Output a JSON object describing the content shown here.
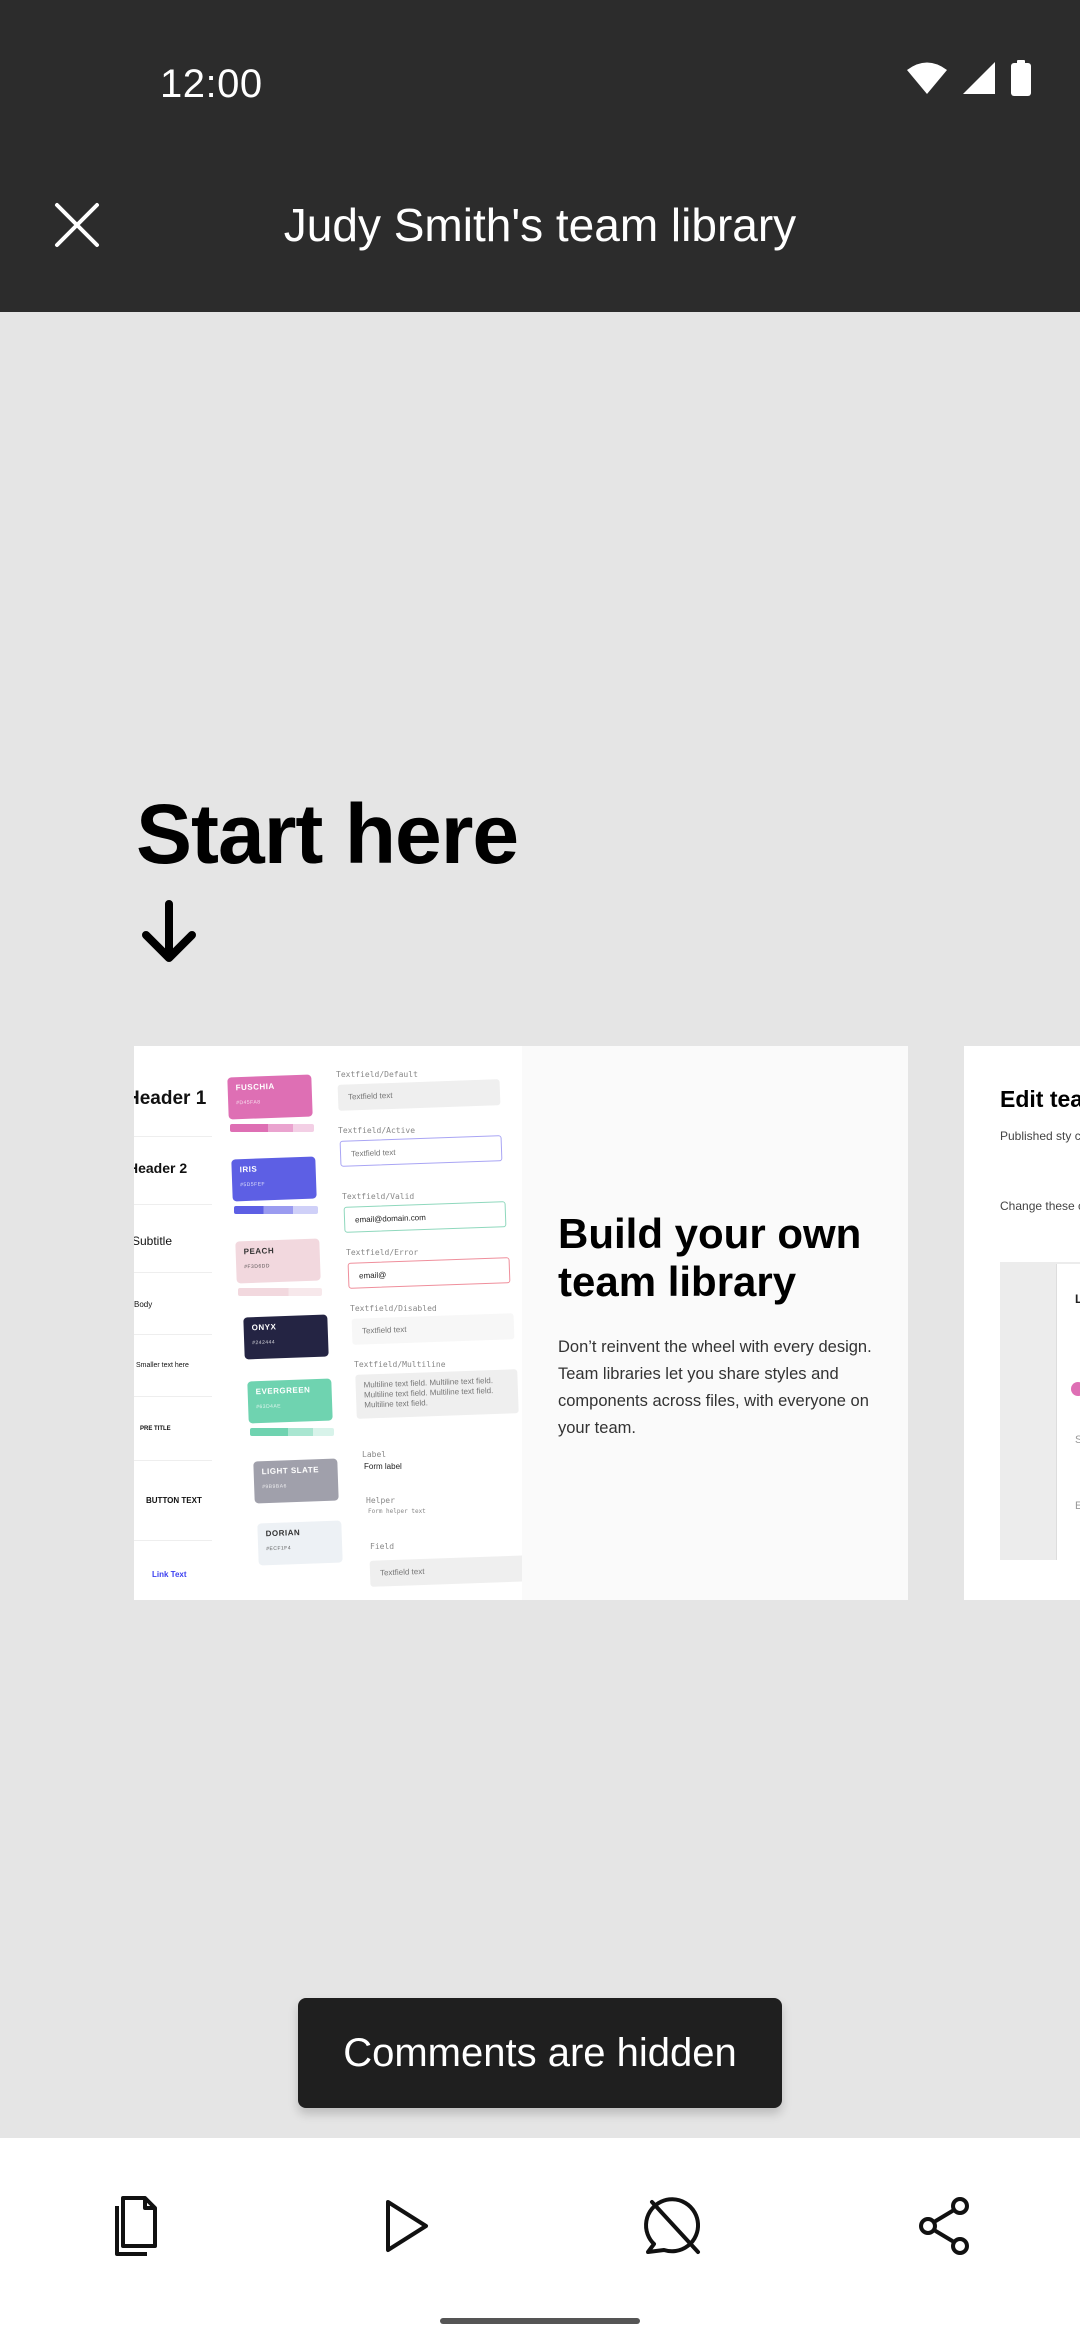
{
  "status_bar": {
    "time": "12:00",
    "icons": [
      "wifi-icon",
      "cellular-icon",
      "battery-icon"
    ]
  },
  "header": {
    "title": "Judy Smith's team library",
    "close_icon": "close-icon"
  },
  "canvas": {
    "start_heading": "Start here",
    "arrow_icon": "arrow-down-icon",
    "main_frame": {
      "type_styles": [
        "Header 1",
        "Header 2",
        "Subtitle",
        "Body",
        "Smaller text here",
        "PRE TITLE",
        "BUTTON TEXT",
        "Link Text"
      ],
      "swatches": [
        {
          "name": "FUSCHIA",
          "hex": "#D45FA8",
          "color": "#de6fb4"
        },
        {
          "name": "IRIS",
          "hex": "#5D5FEF",
          "color": "#5d5fe4"
        },
        {
          "name": "PEACH",
          "hex": "#F3D6DD",
          "color": "#f2d8de"
        },
        {
          "name": "ONYX",
          "hex": "#242444",
          "color": "#242443"
        },
        {
          "name": "EVERGREEN",
          "hex": "#63D4AE",
          "color": "#6fd3b0"
        },
        {
          "name": "LIGHT SLATE",
          "hex": "#9B9BA6",
          "color": "#a0a0ab"
        },
        {
          "name": "DORIAN",
          "hex": "#ECF1F4",
          "color": "#edf1f5"
        }
      ],
      "textfields": [
        {
          "label": "Textfield/Default",
          "value": "Textfield text"
        },
        {
          "label": "Textfield/Active",
          "value": "Textfield text"
        },
        {
          "label": "Textfield/Valid",
          "value": "email@domain.com"
        },
        {
          "label": "Textfield/Error",
          "value": "email@"
        },
        {
          "label": "Textfield/Disabled",
          "value": "Textfield text"
        },
        {
          "label": "Textfield/Multiline",
          "value": "Multiline text field. Multiline text field. Multiline text field. Multiline text field. Multiline text field."
        }
      ],
      "form": {
        "label_caption": "Label",
        "label_value": "Form label",
        "helper_caption": "Helper",
        "helper_value": "Form helper text",
        "field_caption": "Field",
        "field_value": "Textfield text"
      },
      "heading": "Build your own team library",
      "body": "Don’t reinvent the wheel with every design. Team libraries let you share styles and components across files, with everyone on your team."
    },
    "second_frame": {
      "heading": "Edit tea",
      "paragraph_1": "Published sty can be used b these styles v",
      "paragraph_2": "Change these color layer an",
      "panel_letters": [
        "L",
        "S",
        "E"
      ]
    }
  },
  "toast": {
    "message": "Comments are hidden"
  },
  "bottom_bar": {
    "items": [
      {
        "name": "pages-icon"
      },
      {
        "name": "play-icon"
      },
      {
        "name": "comments-hidden-icon"
      },
      {
        "name": "share-icon"
      }
    ]
  }
}
